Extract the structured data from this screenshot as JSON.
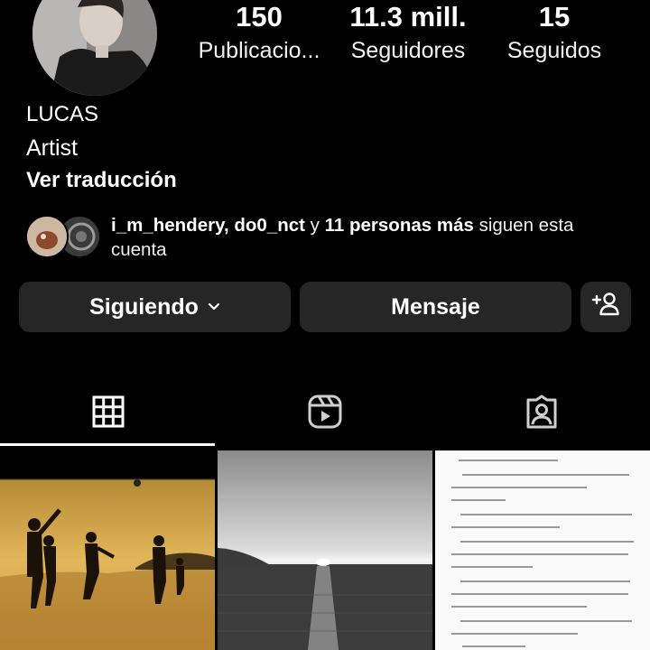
{
  "profile": {
    "name": "LUCAS",
    "bio": "Artist",
    "translate_label": "Ver traducción"
  },
  "stats": [
    {
      "value": "150",
      "label": "Publicacio..."
    },
    {
      "value": "11.3 mill.",
      "label": "Seguidores"
    },
    {
      "value": "15",
      "label": "Seguidos"
    }
  ],
  "mutual": {
    "user_1": "i_m_hendery",
    "separator": ", ",
    "user_2": "do0_nct",
    "conjunction": " y ",
    "others": "11 personas más",
    "suffix": " siguen esta cuenta"
  },
  "actions": {
    "following_label": "Siguiendo",
    "message_label": "Mensaje"
  },
  "tabs": [
    {
      "icon": "grid-icon",
      "active": true
    },
    {
      "icon": "reels-icon",
      "active": false
    },
    {
      "icon": "tagged-icon",
      "active": false
    }
  ],
  "colors": {
    "background": "#000000",
    "button_bg": "#262626",
    "text": "#ffffff"
  }
}
